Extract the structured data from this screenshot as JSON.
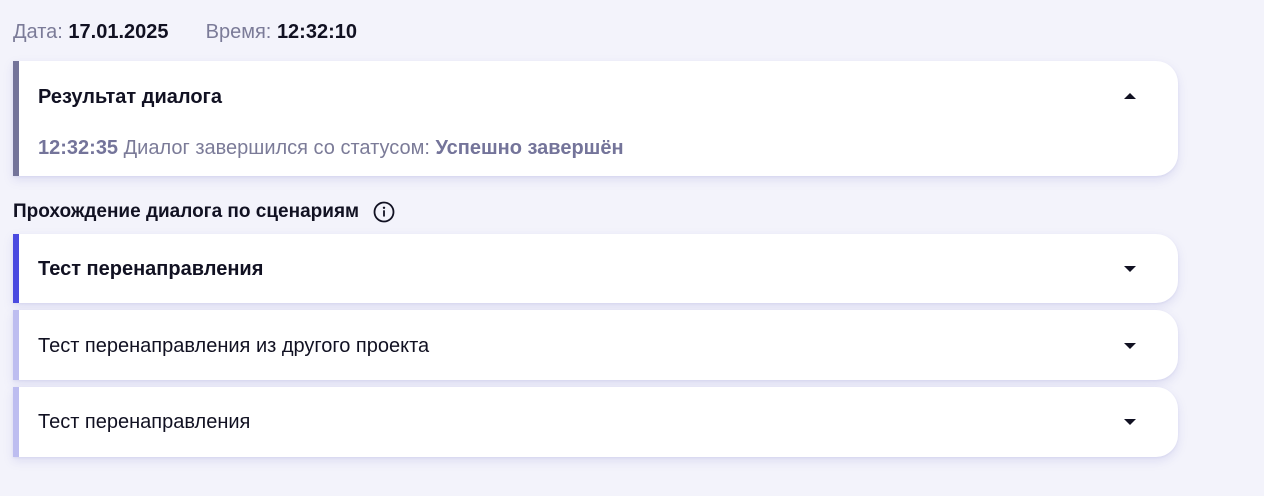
{
  "meta": {
    "date_label": "Дата:",
    "date_value": "17.01.2025",
    "time_label": "Время:",
    "time_value": "12:32:10"
  },
  "result_card": {
    "title": "Результат диалога",
    "time": "12:32:35",
    "message": "Диалог завершился со статусом:",
    "status": "Успешно завершён",
    "expanded": true,
    "accent_color": "#74749a"
  },
  "scenarios": {
    "heading": "Прохождение диалога по сценариям",
    "info_icon": "info-circle-icon",
    "items": [
      {
        "label": "Тест перенаправления",
        "active": true,
        "accent_color": "#4a4ae0",
        "expanded": false
      },
      {
        "label": "Тест перенаправления из другого проекта",
        "active": false,
        "accent_color": "#bdbdf0",
        "expanded": false
      },
      {
        "label": "Тест перенаправления",
        "active": false,
        "accent_color": "#bdbdf0",
        "expanded": false
      }
    ]
  }
}
